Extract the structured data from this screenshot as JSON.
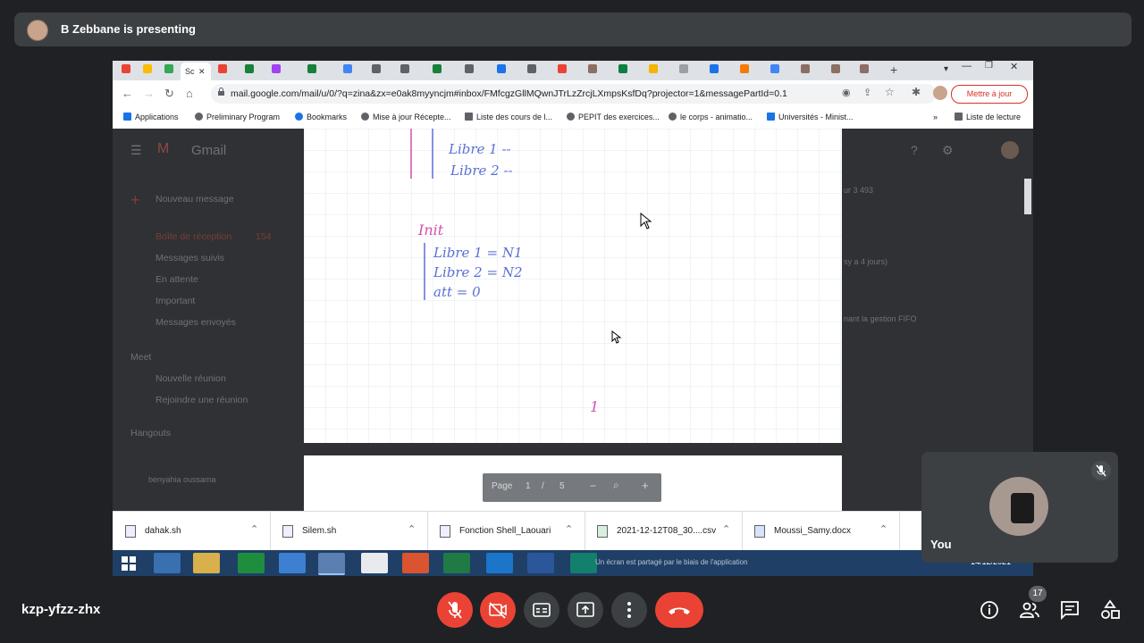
{
  "presenter": {
    "text": "B Zebbane is presenting"
  },
  "browser": {
    "active_tab_label": "Sc",
    "url": "mail.google.com/mail/u/0/?q=zina&zx=e0ak8myyncjm#inbox/FMfcgzGllMQwnJTrLzZrcjLXmpsKsfDq?projector=1&messagePartId=0.1",
    "update_button": "Mettre à jour",
    "bookmarks": [
      "Applications",
      "Preliminary Program",
      "Bookmarks",
      "Mise à jour Récepte...",
      "Liste des cours de l...",
      "PEPIT des exercices...",
      "le corps - animatio...",
      "Universités - Minist..."
    ],
    "reading_list": "Liste de lecture"
  },
  "gmail": {
    "brand": "Gmail",
    "compose": "Nouveau message",
    "nav": [
      "Boîte de réception",
      "Messages suivis",
      "En attente",
      "Important",
      "Messages envoyés"
    ],
    "inbox_count": "154",
    "meet_header": "Meet",
    "meet_items": [
      "Nouvelle réunion",
      "Rejoindre une réunion"
    ],
    "hangouts_header": "Hangouts",
    "hangouts_contact": "benyahia oussama",
    "right_snippet": "nant la gestion FIFO",
    "right_date": "sy a 4 jours)",
    "pager_text": "ur 3 493"
  },
  "pdf": {
    "page_label": "Page",
    "page_current": "1",
    "page_sep": "/",
    "page_total": "5",
    "minus": "−",
    "plus": "+",
    "handwriting": {
      "line1": "Libre 1 --",
      "line2": "Libre 2 --",
      "init_title": "Init",
      "init1": "Libre 1 = N1",
      "init2": "Libre 2 = N2",
      "init3": "att = 0",
      "page_mark": "1"
    }
  },
  "downloads": [
    {
      "name": "dahak.sh"
    },
    {
      "name": "Silem.sh"
    },
    {
      "name": "Fonction Shell_Laouari"
    },
    {
      "name": "2021-12-12T08_30....csv"
    },
    {
      "name": "Moussi_Samy.docx"
    }
  ],
  "taskbar": {
    "notification": "Un écran est partagé par le biais de l'application",
    "date": "14/12/2021"
  },
  "self_view": {
    "name": "You"
  },
  "meeting": {
    "code": "kzp-yfzz-zhx",
    "people_count": "17"
  },
  "colors": {
    "page_bg": "#202124",
    "tile_bg": "#3c4043",
    "danger": "#ea4335",
    "ink_blue": "#5b6fd6",
    "ink_pink": "#d44fae"
  }
}
